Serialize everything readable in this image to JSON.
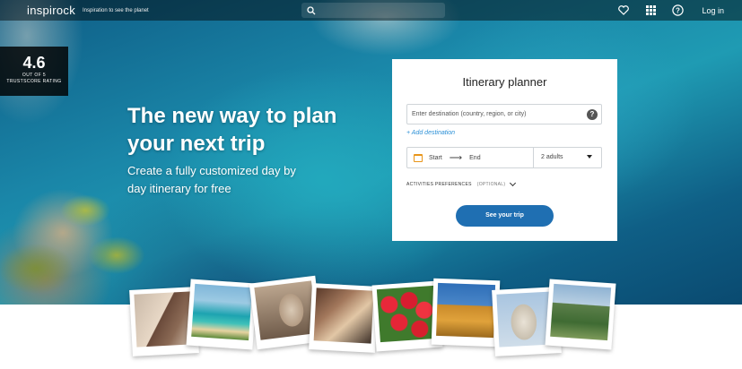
{
  "header": {
    "logo": "inspirock",
    "tagline": "Inspiration to see the planet",
    "login": "Log in"
  },
  "icons": {
    "search": "search-icon",
    "favorites": "heart-icon",
    "apps": "grid-icon",
    "help": "question-icon"
  },
  "trust": {
    "score": "4.6",
    "out_of": "OUT OF 5",
    "label": "TRUSTSCORE RATING"
  },
  "hero": {
    "headline": "The new way to plan your next trip",
    "subline": "Create a fully customized day by day itinerary for free"
  },
  "planner": {
    "title": "Itinerary planner",
    "destination_placeholder": "Enter destination (country, region, or city)",
    "add_destination": "+ Add destination",
    "start_label": "Start",
    "end_label": "End",
    "travelers": "2 adults",
    "preferences_label": "ACTIVITIES PREFERENCES",
    "preferences_optional": "(OPTIONAL)",
    "cta": "See your trip"
  },
  "photos": [
    {
      "name": "friends-photo"
    },
    {
      "name": "beach-photo"
    },
    {
      "name": "statue-photo"
    },
    {
      "name": "selfie-photo"
    },
    {
      "name": "tulips-photo"
    },
    {
      "name": "eiffel-photo"
    },
    {
      "name": "monument-photo"
    },
    {
      "name": "mountain-photo"
    }
  ],
  "colors": {
    "accent": "#1f6fb2",
    "link": "#2a8fd6",
    "calendar": "#e8951a"
  }
}
